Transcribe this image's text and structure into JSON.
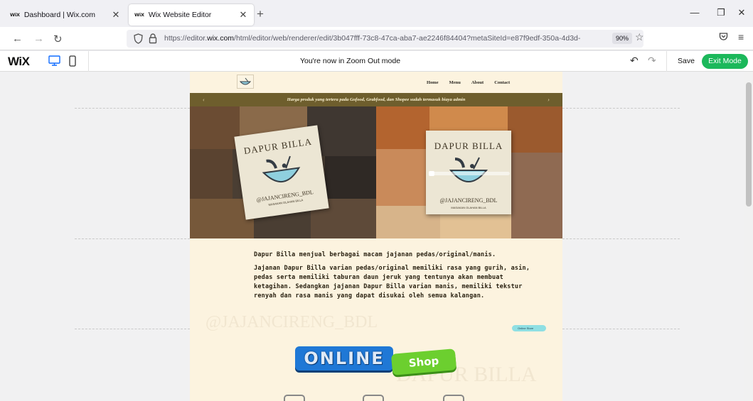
{
  "browser": {
    "tabs": [
      {
        "favicon": "WiX",
        "label": "Dashboard | Wix.com"
      },
      {
        "favicon": "WiX",
        "label": "Wix Website Editor",
        "active": true
      }
    ],
    "url_prefix": "https://editor.",
    "url_domain": "wix.com",
    "url_rest": "/html/editor/web/renderer/edit/3b047fff-73c8-47ca-aba7-ae2246f84404?metaSiteId=e87f9edf-350a-4d3d-",
    "zoom": "90%"
  },
  "editor": {
    "logo": "WiX",
    "mode_message": "You're now in Zoom Out mode",
    "save_label": "Save",
    "exit_label": "Exit Mode",
    "accent_color": "#1cb85b"
  },
  "site": {
    "nav": [
      "Home",
      "Menu",
      "About",
      "Contact"
    ],
    "announcement": "Harga produk yang tertera pada Gofood, Grabfood, dan Shopee sudah termasuk biaya admin",
    "brand_name": "DAPUR BILLA",
    "brand_handle": "@JAJANCIRENG_BDL",
    "brand_tagline": "MASAKAN OLAHAN BILLA",
    "desc_1": "Dapur Billa menjual berbagai macam jajanan pedas/original/manis.",
    "desc_2": "Jajanan Dapur Billa varian pedas/original memiliki rasa yang gurih, asin, pedas serta memiliki taburan daun jeruk yang tentunya akan membuat ketagihan. Sedangkan jajanan Dapur Billa varian manis, memiliki tekstur renyah dan rasa manis yang dapat disukai oleh semua kalangan.",
    "online_label": "ONLINE",
    "shop_label": "Shop",
    "pill_label": "Online Store"
  }
}
